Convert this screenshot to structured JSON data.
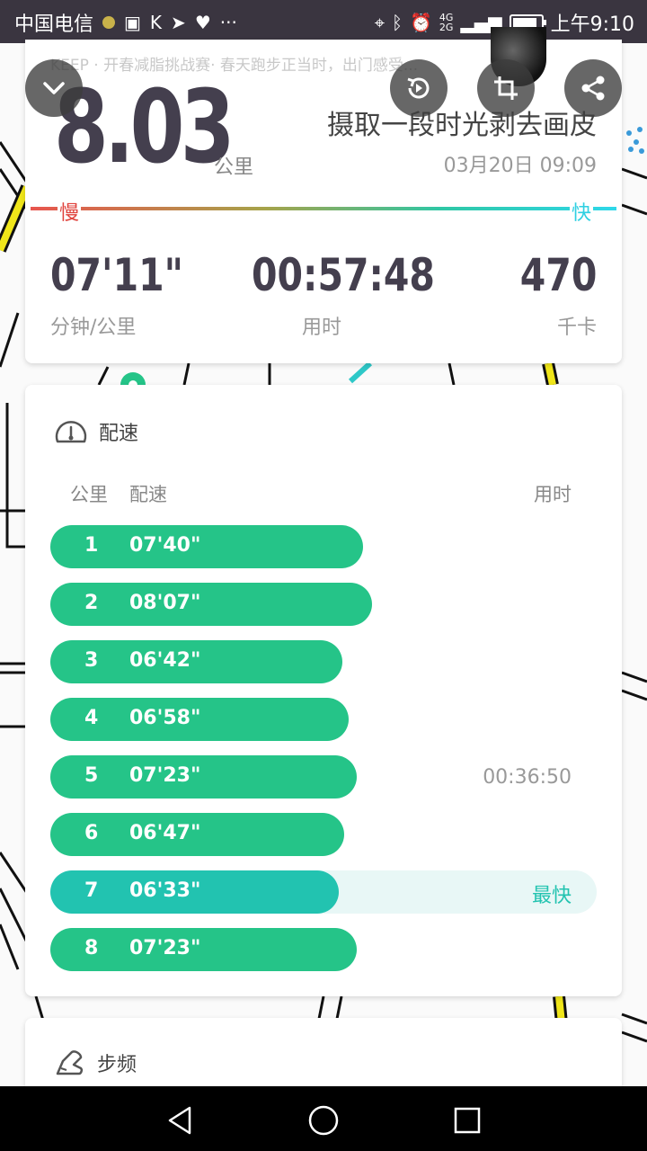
{
  "status_bar": {
    "carrier": "中国电信",
    "time": "上午9:10",
    "network_top": "4G",
    "network_bottom": "2G",
    "battery_level": 0.85,
    "more": "···"
  },
  "summary": {
    "ticker": "KEEP · 开春减脂挑战赛· 春天跑步正当时，出门感受...",
    "distance": "8.03",
    "distance_unit": "公里",
    "title": "摄取一段时光剥去画皮",
    "date": "03月20日 09:09",
    "speed_scale": {
      "slow": "慢",
      "fast": "快"
    },
    "stats": [
      {
        "value": "07'11\"",
        "label": "分钟/公里"
      },
      {
        "value": "00:57:48",
        "label": "用时"
      },
      {
        "value": "470",
        "label": "千卡"
      }
    ]
  },
  "toolbar": {
    "collapse_icon": "chevron-down-icon",
    "replay_icon": "replay-icon",
    "crop_icon": "crop-icon",
    "share_icon": "share-icon"
  },
  "pace_card": {
    "title": "配速",
    "headers": {
      "km": "公里",
      "pace": "配速",
      "time": "用时"
    },
    "rows": [
      {
        "km": "1",
        "pace": "07'40\"",
        "bar_fraction": 0.572,
        "elapsed": "",
        "tag": ""
      },
      {
        "km": "2",
        "pace": "08'07\"",
        "bar_fraction": 0.589,
        "elapsed": "",
        "tag": ""
      },
      {
        "km": "3",
        "pace": "06'42\"",
        "bar_fraction": 0.535,
        "elapsed": "",
        "tag": ""
      },
      {
        "km": "4",
        "pace": "06'58\"",
        "bar_fraction": 0.546,
        "elapsed": "",
        "tag": ""
      },
      {
        "km": "5",
        "pace": "07'23\"",
        "bar_fraction": 0.561,
        "elapsed": "00:36:50",
        "tag": ""
      },
      {
        "km": "6",
        "pace": "06'47\"",
        "bar_fraction": 0.538,
        "elapsed": "",
        "tag": ""
      },
      {
        "km": "7",
        "pace": "06'33\"",
        "bar_fraction": 0.528,
        "elapsed": "",
        "tag": "最快",
        "fastest": true
      },
      {
        "km": "8",
        "pace": "07'23\"",
        "bar_fraction": 0.561,
        "elapsed": "",
        "tag": ""
      }
    ],
    "colors": {
      "bar": "#25c488",
      "fastest_bar": "#22c3b0",
      "fastest_track": "#e8f7f6"
    }
  },
  "cadence_card": {
    "title": "步频"
  }
}
